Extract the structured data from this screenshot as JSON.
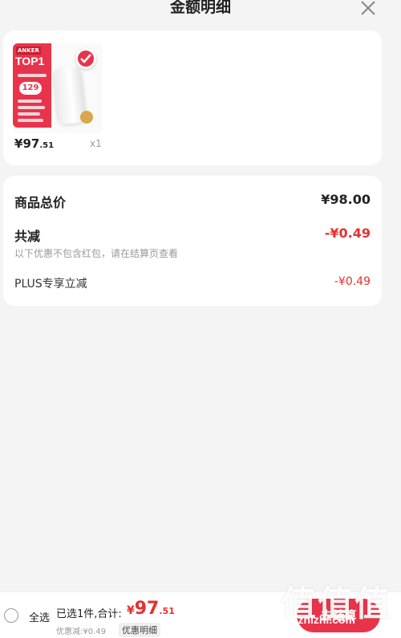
{
  "header": {
    "title": "金额明细",
    "close_icon": "close-icon"
  },
  "product": {
    "thumbnail": {
      "brand": "ANKER",
      "headline": "TOP1",
      "price_tag": "129"
    },
    "price_symbol": "¥",
    "price_int": "97",
    "price_cents": ".51",
    "quantity": "x1"
  },
  "summary": {
    "goods_total_label": "商品总价",
    "goods_total_value": "¥98.00",
    "total_discount_label": "共减",
    "total_discount_value": "-¥0.49",
    "note": "以下优惠不包含红包，请在结算页查看",
    "plus_label": "PLUS专享立减",
    "plus_value": "-¥0.49"
  },
  "bottom_bar": {
    "select_all": "全选",
    "selected_text": "已选1件,合计:",
    "total_symbol": "¥",
    "total_int": "97",
    "total_cents": ".51",
    "discount_text": "优惠减:¥0.49",
    "detail_link": "优惠明细",
    "checkout_label": "去结算"
  },
  "watermark": {
    "text": "值值值",
    "url": "zhizhizhi.com"
  },
  "colors": {
    "accent": "#e5302f",
    "button": "#e8344b",
    "background": "#f4f4f4"
  }
}
